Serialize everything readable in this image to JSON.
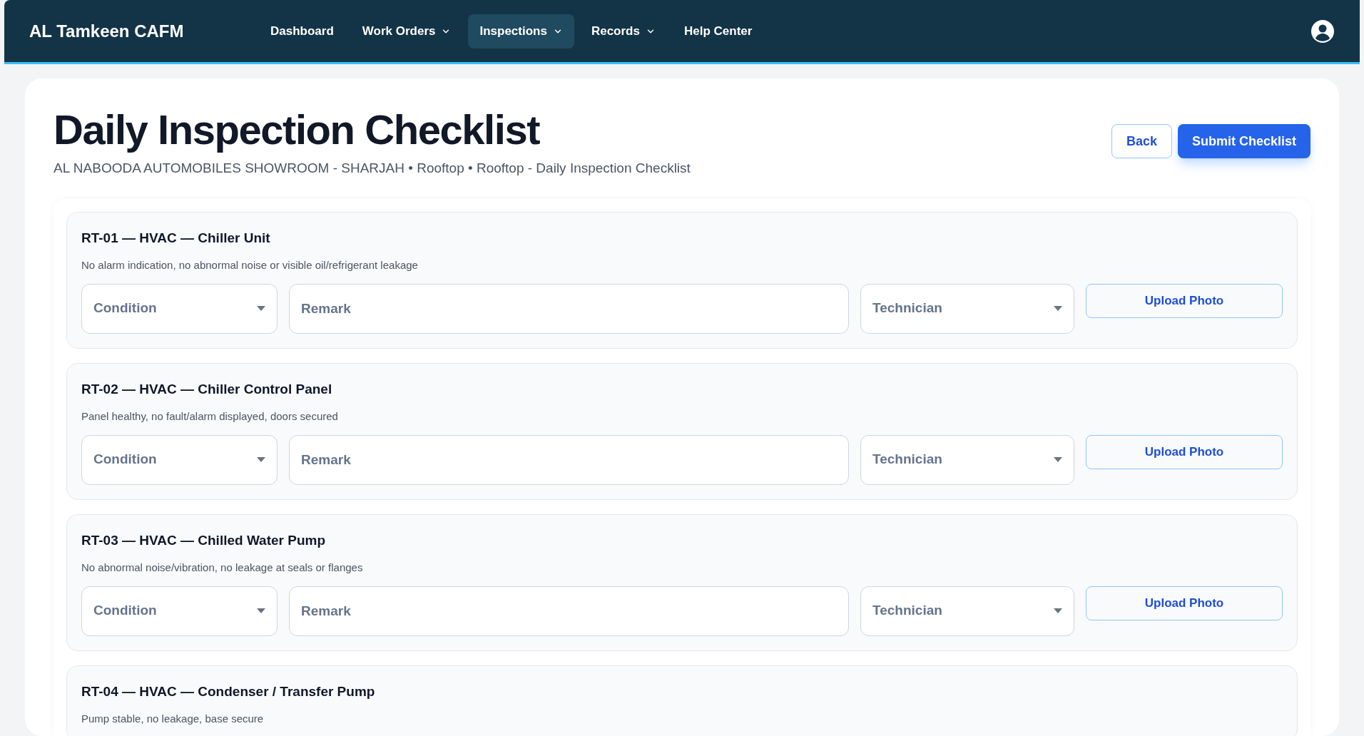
{
  "navbar": {
    "brand": "AL Tamkeen CAFM",
    "items": [
      {
        "label": "Dashboard",
        "dropdown": false,
        "selected": false
      },
      {
        "label": "Work Orders",
        "dropdown": true,
        "selected": false
      },
      {
        "label": "Inspections",
        "dropdown": true,
        "selected": true
      },
      {
        "label": "Records",
        "dropdown": true,
        "selected": false
      },
      {
        "label": "Help Center",
        "dropdown": false,
        "selected": false
      }
    ]
  },
  "header": {
    "title": "Daily Inspection Checklist",
    "subtitle": "AL NABOODA AUTOMOBILES SHOWROOM - SHARJAH • Rooftop • Rooftop - Daily Inspection Checklist",
    "buttons": [
      {
        "label": "Back",
        "kind": "secondary"
      },
      {
        "label": "Submit Checklist",
        "kind": "primary"
      }
    ]
  },
  "checklist_items": [
    {
      "title": "RT-01 — HVAC — Chiller Unit",
      "description": "No alarm indication, no abnormal noise or visible oil/refrigerant leakage",
      "condition": {
        "placeholder": "Condition"
      },
      "remark": {
        "placeholder": "Remark"
      },
      "technician": {
        "placeholder": "Technician"
      },
      "upload": "Upload Photo"
    },
    {
      "title": "RT-02 — HVAC — Chiller Control Panel",
      "description": "Panel healthy, no fault/alarm displayed, doors secured",
      "condition": {
        "placeholder": "Condition"
      },
      "remark": {
        "placeholder": "Remark"
      },
      "technician": {
        "placeholder": "Technician"
      },
      "upload": "Upload Photo"
    },
    {
      "title": "RT-03 — HVAC — Chilled Water Pump",
      "description": "No abnormal noise/vibration, no leakage at seals or flanges",
      "condition": {
        "placeholder": "Condition"
      },
      "remark": {
        "placeholder": "Remark"
      },
      "technician": {
        "placeholder": "Technician"
      },
      "upload": "Upload Photo"
    },
    {
      "title": "RT-04 — HVAC — Condenser / Transfer Pump",
      "description": "Pump stable, no leakage, base secure"
    }
  ]
}
